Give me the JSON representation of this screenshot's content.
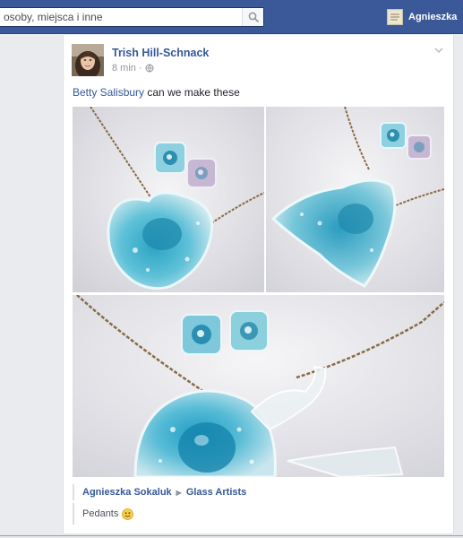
{
  "header": {
    "search_placeholder": "osoby, miejsca i inne",
    "profile_name": "Agnieszka",
    "bar_color": "#3b5998"
  },
  "post": {
    "author": "Trish Hill-Schnack",
    "time": "8 min",
    "separator": "·",
    "privacy_icon": "globe-icon",
    "mention": "Betty Salisbury",
    "text": " can we make these",
    "photos": [
      {
        "name": "heart-pendant-photo",
        "subject": "blue glass heart pendant with square earrings"
      },
      {
        "name": "fish-pendant-photo",
        "subject": "blue glass pendant with square earrings"
      },
      {
        "name": "whale-pendant-photo",
        "subject": "close-up blue glass pendant with square earrings"
      }
    ],
    "shared_by": "Agnieszka Sokaluk",
    "arrow": "▶",
    "group": "Glass Artists",
    "comment": "Pedants"
  }
}
